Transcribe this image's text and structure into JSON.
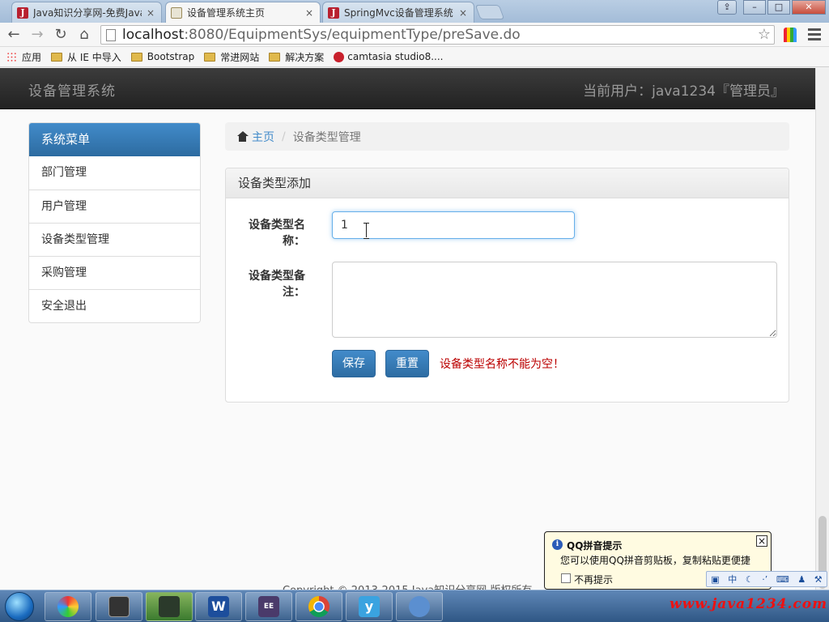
{
  "browser": {
    "tabs": [
      {
        "title": "Java知识分享网-免费Java",
        "close": "×",
        "icon": "java-favicon"
      },
      {
        "title": "设备管理系统主页",
        "close": "×",
        "icon": "chart-favicon",
        "active": true
      },
      {
        "title": "SpringMvc设备管理系统",
        "close": "×",
        "icon": "java-favicon"
      }
    ],
    "window_buttons": {
      "user": "⇪",
      "minimize": "–",
      "maximize": "□",
      "close": "✕"
    },
    "url_host": "localhost",
    "url_path": ":8080/EquipmentSys/equipmentType/preSave.do",
    "bookmarks": [
      {
        "label": "应用",
        "icon": "apps-icon"
      },
      {
        "label": "从 IE 中导入",
        "icon": "folder-icon"
      },
      {
        "label": "Bootstrap",
        "icon": "folder-icon"
      },
      {
        "label": "常进网站",
        "icon": "folder-icon"
      },
      {
        "label": "解决方案",
        "icon": "folder-icon"
      },
      {
        "label": "camtasia studio8....",
        "icon": "camtasia-icon"
      }
    ]
  },
  "app": {
    "brand": "设备管理系统",
    "current_user": "当前用户：java1234『管理员』",
    "sidebar": {
      "header": "系统菜单",
      "items": [
        {
          "label": "部门管理"
        },
        {
          "label": "用户管理"
        },
        {
          "label": "设备类型管理"
        },
        {
          "label": "采购管理"
        },
        {
          "label": "安全退出"
        }
      ]
    },
    "breadcrumb": {
      "home": "主页",
      "separator": "/",
      "current": "设备类型管理"
    },
    "panel": {
      "title": "设备类型添加",
      "name_label_line1": "设备类型名",
      "name_label_line2": "称：",
      "name_value": "1",
      "remark_label_line1": "设备类型备",
      "remark_label_line2": "注：",
      "remark_value": "",
      "save_button": "保存",
      "reset_button": "重置",
      "error": "设备类型名称不能为空！"
    },
    "footer": "Copyright © 2013-2015 Java知识分享网 版权所有"
  },
  "qq_popup": {
    "title": "QQ拼音提示",
    "body": "您可以使用QQ拼音剪贴板，复制粘贴更便捷",
    "checkbox_label": "不再提示",
    "close": "×"
  },
  "ime_toolbar": {
    "mode": "中"
  },
  "taskbar": {
    "apps": [
      "windows-start",
      "pinwheel-icon",
      "terminal-icon",
      "video-recorder-icon",
      "word-icon",
      "javaee-ide-icon",
      "chrome-icon",
      "yinxiang-icon",
      "dolphin-icon"
    ],
    "watermark": "www.java1234.com"
  },
  "colors": {
    "primary": "#428bca",
    "navbar": "#222222",
    "error": "#bb0000"
  }
}
